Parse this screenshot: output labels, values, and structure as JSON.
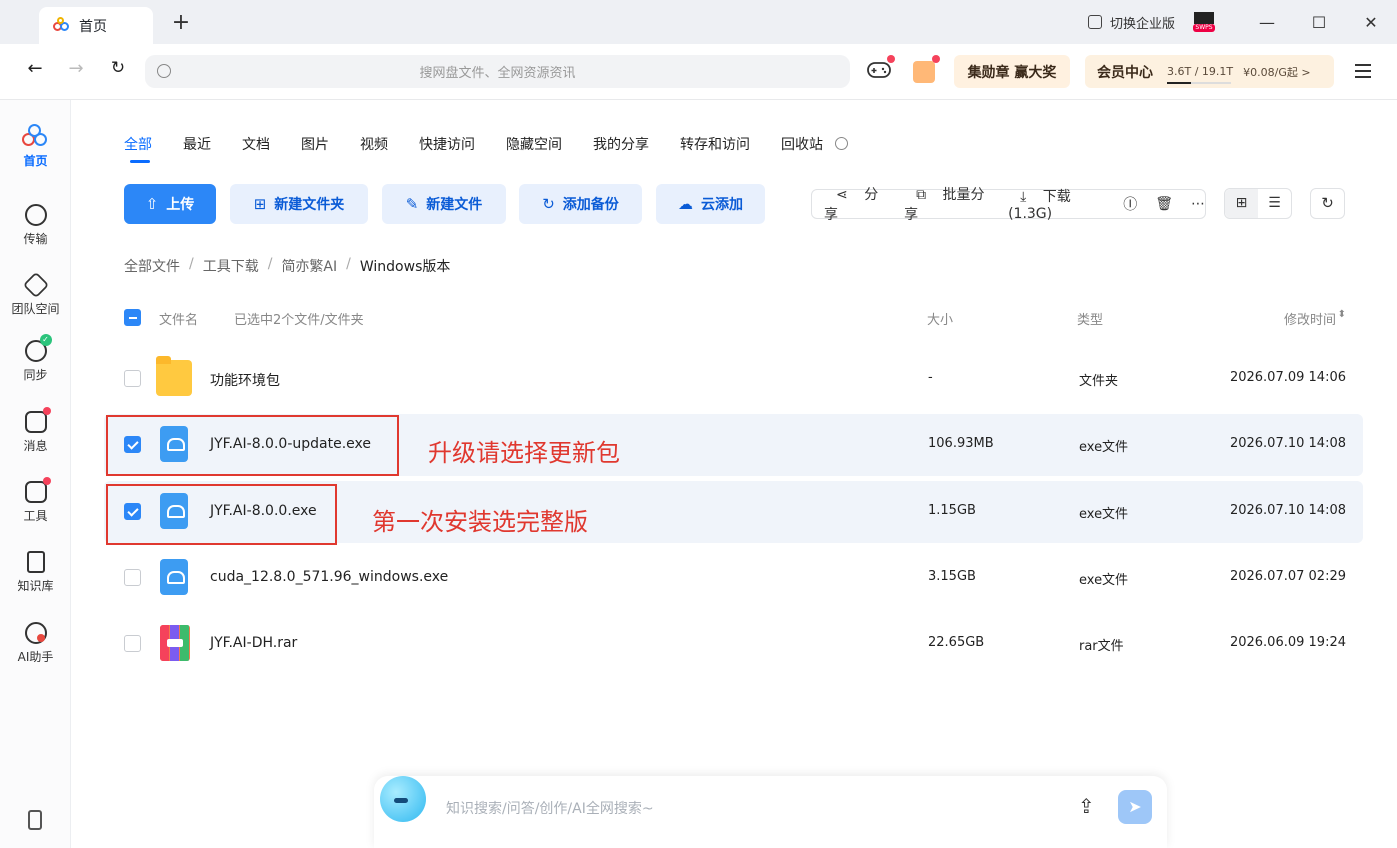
{
  "window": {
    "tab_title": "首页",
    "new_tab": "+",
    "switch_enterprise": "切换企业版",
    "swp_label": "SWPS"
  },
  "toolbar": {
    "search_placeholder": "搜网盘文件、全网资源资讯",
    "prize_label": "集勋章 赢大奖",
    "vip_label": "会员中心",
    "storage": "3.6T / 19.1T",
    "vip_price": "¥0.08/G起 >"
  },
  "sidebar": {
    "items": [
      {
        "label": "首页",
        "icon": "home-icon"
      },
      {
        "label": "传输",
        "icon": "transfer-icon"
      },
      {
        "label": "团队空间",
        "icon": "team-space-icon"
      },
      {
        "label": "同步",
        "icon": "sync-icon"
      },
      {
        "label": "消息",
        "icon": "message-icon"
      },
      {
        "label": "工具",
        "icon": "tools-icon"
      },
      {
        "label": "知识库",
        "icon": "knowledge-base-icon"
      },
      {
        "label": "AI助手",
        "icon": "ai-assistant-icon"
      }
    ]
  },
  "category_tabs": [
    "全部",
    "最近",
    "文档",
    "图片",
    "视频",
    "快捷访问",
    "隐藏空间",
    "我的分享",
    "转存和访问",
    "回收站"
  ],
  "buttons": {
    "upload": "上传",
    "new_folder": "新建文件夹",
    "new_file": "新建文件",
    "add_backup": "添加备份",
    "cloud_add": "云添加"
  },
  "actions": {
    "share": "分享",
    "batch_share": "批量分享",
    "download": "下载(1.3G)"
  },
  "breadcrumb": [
    "全部文件",
    "工具下载",
    "简亦繁AI",
    "Windows版本"
  ],
  "table": {
    "col_name": "文件名",
    "selection": "已选中2个文件/文件夹",
    "col_size": "大小",
    "col_type": "类型",
    "col_date": "修改时间",
    "rows": [
      {
        "name": "功能环境包",
        "size": "-",
        "type": "文件夹",
        "date": "2026.07.09 14:06",
        "icon": "folder-icon",
        "selected": false
      },
      {
        "name": "JYF.AI-8.0.0-update.exe",
        "size": "106.93MB",
        "type": "exe文件",
        "date": "2026.07.10 14:08",
        "icon": "exe-file-icon",
        "selected": true
      },
      {
        "name": "JYF.AI-8.0.0.exe",
        "size": "1.15GB",
        "type": "exe文件",
        "date": "2026.07.10 14:08",
        "icon": "exe-file-icon",
        "selected": true
      },
      {
        "name": "cuda_12.8.0_571.96_windows.exe",
        "size": "3.15GB",
        "type": "exe文件",
        "date": "2026.07.07 02:29",
        "icon": "exe-file-icon",
        "selected": false
      },
      {
        "name": "JYF.AI-DH.rar",
        "size": "22.65GB",
        "type": "rar文件",
        "date": "2026.06.09 19:24",
        "icon": "rar-file-icon",
        "selected": false
      }
    ]
  },
  "annotations": {
    "update_note": "升级请选择更新包",
    "install_note": "第一次安装选完整版",
    "color": "#e0382f"
  },
  "ai_bar": {
    "placeholder": "知识搜索/问答/创作/AI全网搜索~"
  },
  "colors": {
    "accent": "#2c87f7",
    "badge": "#f5425b"
  }
}
